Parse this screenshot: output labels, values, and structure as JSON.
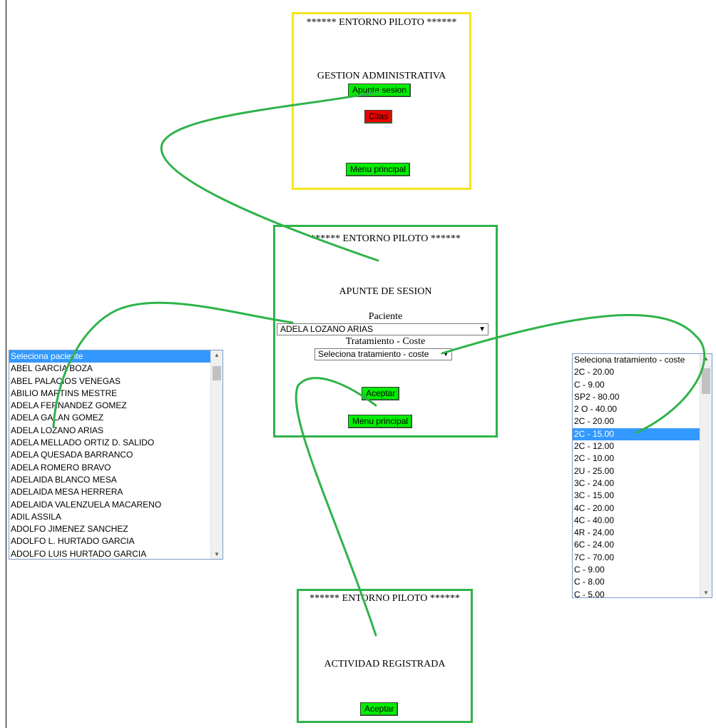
{
  "screen1": {
    "header": "****** ENTORNO PILOTO ******",
    "title": "GESTION ADMINISTRATIVA",
    "btn_apunte": "Apunte sesion",
    "btn_citas": "Citas",
    "btn_menu": "Menu principal"
  },
  "screen2": {
    "header": "****** ENTORNO PILOTO ******",
    "title": "APUNTE DE SESION",
    "label_paciente": "Paciente",
    "paciente_value": "ADELA LOZANO ARIAS",
    "label_tratamiento": "Tratamiento - Coste",
    "tratamiento_value": "Seleciona tratamiento - coste",
    "btn_aceptar": "Aceptar",
    "btn_menu": "Menu principal"
  },
  "screen3": {
    "header": "****** ENTORNO PILOTO ******",
    "title": "ACTIVIDAD REGISTRADA",
    "btn_aceptar": "Aceptar"
  },
  "patient_list": {
    "items": [
      "Seleciona paciente",
      "ABEL GARCIA BOZA",
      "ABEL PALACIOS VENEGAS",
      "ABILIO MARTINS MESTRE",
      "ADELA FERNANDEZ GOMEZ",
      "ADELA GALAN GOMEZ",
      "ADELA LOZANO ARIAS",
      "ADELA MELLADO ORTIZ D. SALIDO",
      "ADELA QUESADA BARRANCO",
      "ADELA ROMERO BRAVO",
      "ADELAIDA BLANCO MESA",
      "ADELAIDA MESA HERRERA",
      "ADELAIDA VALENZUELA MACARENO",
      "ADIL ASSILA",
      "ADOLFO JIMENEZ SANCHEZ",
      "ADOLFO L. HURTADO GARCIA",
      "ADOLFO LUIS HURTADO GARCIA"
    ],
    "selected_index": 0
  },
  "treatment_list": {
    "items": [
      "Seleciona tratamiento - coste",
      "2C - 20.00",
      "C - 9.00",
      "SP2 - 80.00",
      "2 O - 40.00",
      "2C - 20.00",
      "2C - 15.00",
      "2C - 12.00",
      "2C - 10.00",
      "2U - 25.00",
      "3C - 24.00",
      "3C - 15.00",
      "4C - 20.00",
      "4C - 40.00",
      "4R - 24.00",
      "6C - 24.00",
      "7C - 70.00",
      "C - 9.00",
      "C - 8.00",
      "C - 5.00"
    ],
    "selected_index": 6
  },
  "colors": {
    "frame_admin": "#f5e51b",
    "frame_green": "#2fb34a",
    "button_green": "#00ee00",
    "button_red": "#ee0000",
    "selection": "#3399ff"
  }
}
